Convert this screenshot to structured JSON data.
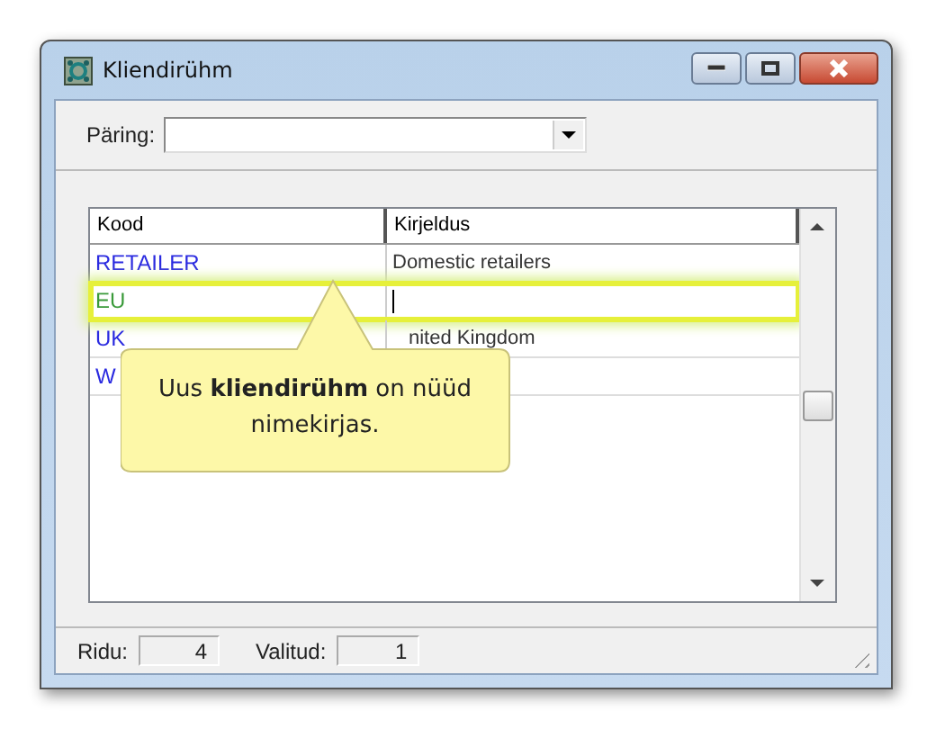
{
  "window": {
    "title": "Kliendirühm"
  },
  "query": {
    "label": "Päring:"
  },
  "table": {
    "columns": [
      "Kood",
      "Kirjeldus"
    ],
    "rows": [
      {
        "code": "RETAILER",
        "description": "Domestic retailers",
        "selected": false,
        "editing": false
      },
      {
        "code": "EU",
        "selected": true,
        "editing": true
      },
      {
        "code": "UK",
        "description": "nited Kingdom",
        "selected": false,
        "editing": false
      },
      {
        "code": "W",
        "selected": false,
        "editing": false
      }
    ]
  },
  "callout": {
    "text": "Uus **kliendirühm** on nüüd nimekirjas."
  },
  "status_bar": {
    "rows_label": "Ridu:",
    "rows_value": "4",
    "selected_label": "Valitud:",
    "selected_value": "1"
  }
}
